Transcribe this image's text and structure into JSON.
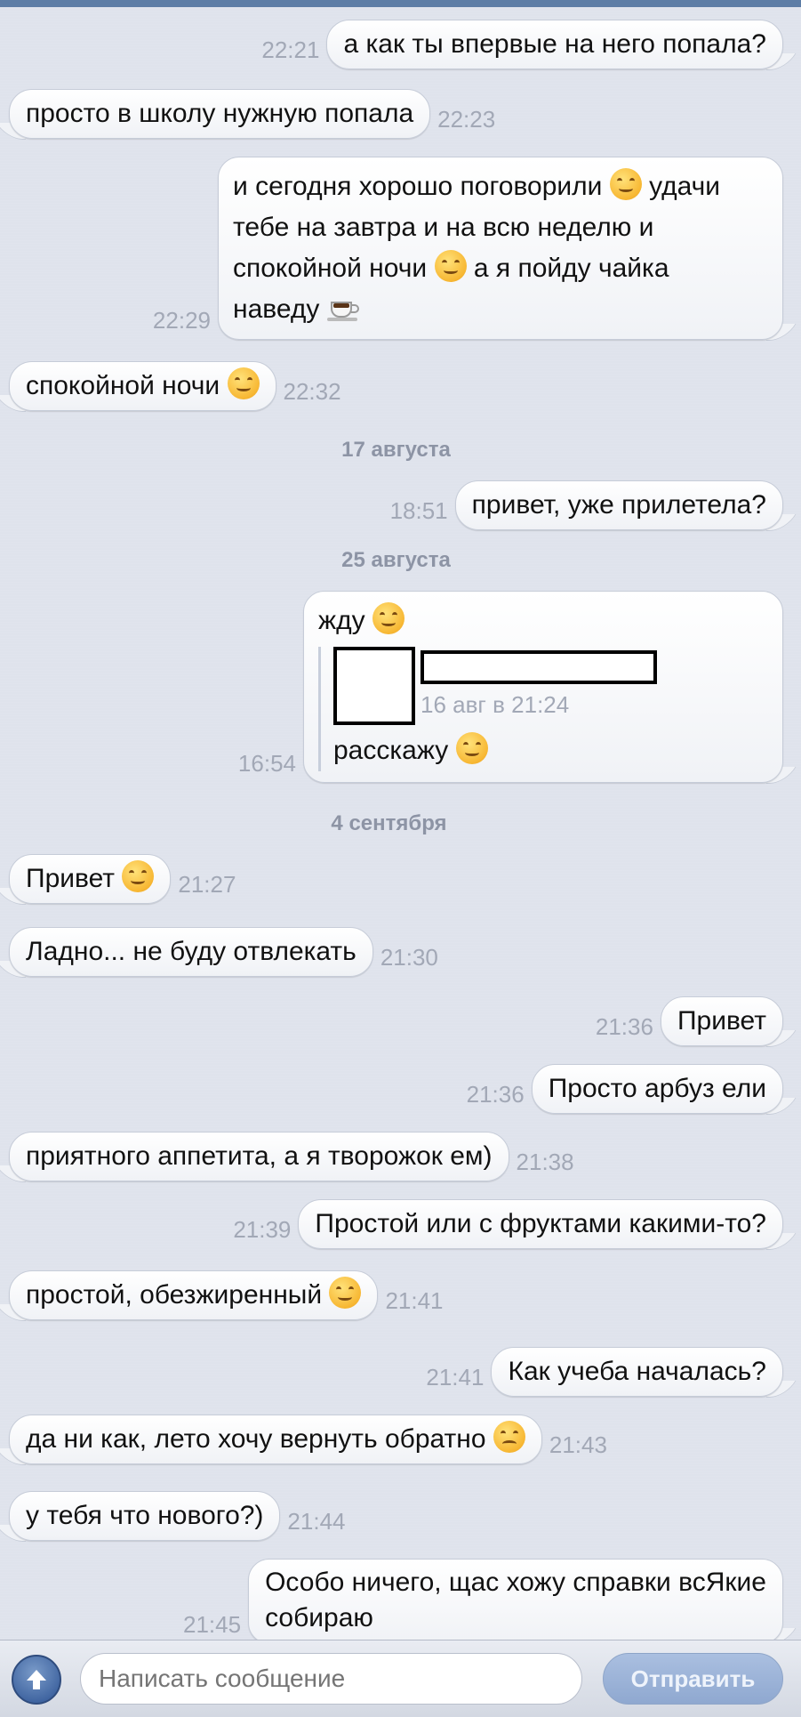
{
  "messages": [
    {
      "dir": "out",
      "time": "22:21",
      "text": "а как ты впервые на него попала?"
    },
    {
      "dir": "in",
      "time": "22:23",
      "text": "просто в школу нужную попала"
    },
    {
      "dir": "out",
      "time": "22:29",
      "lines": [
        "и сегодня хорошо поговорили",
        "удачи",
        "тебе на завтра и на всю неделю и",
        "спокойной ночи",
        "а я пойду чайка",
        "наведу"
      ]
    },
    {
      "dir": "in",
      "time": "22:32",
      "text": "спокойной ночи"
    },
    {
      "date": "17 августа"
    },
    {
      "dir": "out",
      "time": "18:51",
      "text": "привет, уже прилетела?"
    },
    {
      "date": "25 августа"
    },
    {
      "dir": "out",
      "time": "16:54",
      "text": "жду",
      "forwarded": {
        "date": "16 авг в 21:24",
        "text": "расскажу"
      }
    },
    {
      "date": "4 сентября"
    },
    {
      "dir": "in",
      "time": "21:27",
      "text": "Привет"
    },
    {
      "dir": "in",
      "time": "21:30",
      "text": "Ладно... не буду отвлекать"
    },
    {
      "dir": "out",
      "time": "21:36",
      "text": "Привет"
    },
    {
      "dir": "out",
      "time": "21:36",
      "text": "Просто арбуз ели"
    },
    {
      "dir": "in",
      "time": "21:38",
      "text": "приятного аппетита, а я творожок ем)"
    },
    {
      "dir": "out",
      "time": "21:39",
      "text": "Простой или с фруктами какими-то?"
    },
    {
      "dir": "in",
      "time": "21:41",
      "text": "простой, обезжиренный"
    },
    {
      "dir": "out",
      "time": "21:41",
      "text": "Как учеба началась?"
    },
    {
      "dir": "in",
      "time": "21:43",
      "text": "да ни как, лето хочу вернуть обратно"
    },
    {
      "dir": "in",
      "time": "21:44",
      "text": "у тебя что нового?)"
    },
    {
      "dir": "out",
      "time": "21:45",
      "lines": [
        "Особо ничего, щас хожу справки всЯкие",
        "собираю"
      ]
    }
  ],
  "composer": {
    "placeholder": "Написать сообщение",
    "send_label": "Отправить"
  },
  "icons": {
    "attach": "upload-arrow-icon",
    "smile": "smile-emoji-icon",
    "blush": "blush-emoji-icon",
    "wink": "wink-emoji-icon",
    "smirk": "smirk-emoji-icon",
    "tired": "tired-emoji-icon",
    "coffee": "coffee-icon"
  },
  "colors": {
    "background": "#dfe3ec",
    "time": "#a2a8b6",
    "send_button": "#8fa8d0"
  }
}
